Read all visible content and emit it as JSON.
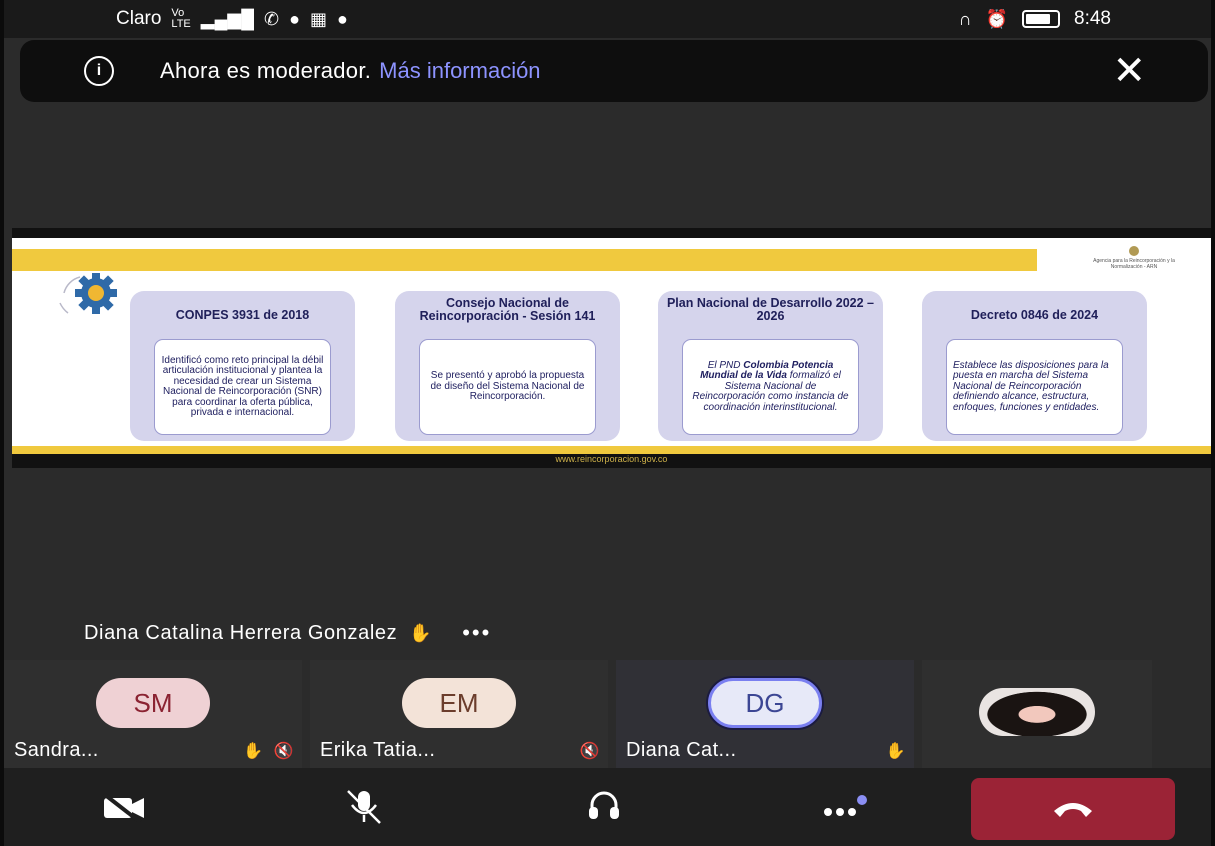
{
  "status_bar": {
    "carrier": "Claro",
    "network": "Vo LTE 4G",
    "time": "8:48",
    "icons_left": [
      "signal-icon",
      "call-icon",
      "facebook-icon",
      "calendar-icon",
      "facebook-icon"
    ],
    "icons_right": [
      "headphones-icon",
      "alarm-icon",
      "battery-icon"
    ]
  },
  "banner": {
    "message": "Ahora es moderador.",
    "link": "Más información"
  },
  "slide": {
    "footer_url": "www.reincorporacion.gov.co",
    "logo_text": "Agencia para la Reincorporación y la Normalización - ARN",
    "cards": [
      {
        "title": "CONPES 3931 de 2018",
        "body": "Identificó como reto principal la débil articulación institucional y plantea la necesidad de crear un Sistema Nacional de Reincorporación (SNR) para coordinar la oferta pública, privada e internacional."
      },
      {
        "title": "Consejo Nacional de Reincorporación - Sesión 141",
        "body": "Se presentó y aprobó la propuesta de diseño del Sistema Nacional de Reincorporación."
      },
      {
        "title": "Plan Nacional de Desarrollo 2022 – 2026",
        "body_prefix": "El PND",
        "body_bold": "Colombia Potencia Mundial de la Vida",
        "body_suffix": "formalizó el Sistema Nacional de Reincorporación como instancia de coordinación interinstitucional."
      },
      {
        "title": "Decreto 0846 de 2024",
        "body": "Establece las disposiciones para la puesta en marcha del Sistema Nacional de Reincorporación definiendo alcance, estructura, enfoques, funciones y entidades."
      }
    ]
  },
  "speaker": {
    "name": "Diana Catalina Herrera Gonzalez",
    "more": "•••"
  },
  "participants": [
    {
      "initials": "SM",
      "name": "Sandra..."
    },
    {
      "initials": "EM",
      "name": "Erika Tatia..."
    },
    {
      "initials": "DG",
      "name": "Diana Cat..."
    },
    {
      "initials": "",
      "name": ""
    }
  ],
  "controls": [
    "camera-off-icon",
    "mic-off-icon",
    "headset-icon",
    "more-icon",
    "hangup-icon"
  ],
  "colors": {
    "banner_link": "#8d93ff",
    "hangup": "#9b2336",
    "slide_yellow": "#f0c93e",
    "card_bg": "#d5d4ec",
    "card_title": "#20205a"
  }
}
